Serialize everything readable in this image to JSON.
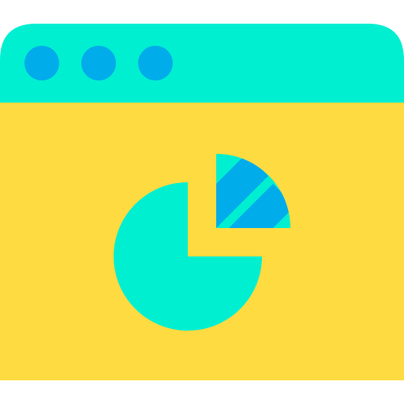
{
  "illustration": {
    "subject": "browser-window-pie-chart-icon",
    "colors": {
      "title_bar": "#00EFD1",
      "window_body": "#FEDB41",
      "window_dots": "#00ACEA",
      "pie_main": "#00EFD1",
      "pie_slice_light": "#00EFD1",
      "pie_slice_stripes": "#00ACEA",
      "background": "#FFFFFF"
    },
    "window_dots_count": 3,
    "pie_chart_share": {
      "main_portion": 0.75,
      "exploded_portion": 0.25
    }
  }
}
